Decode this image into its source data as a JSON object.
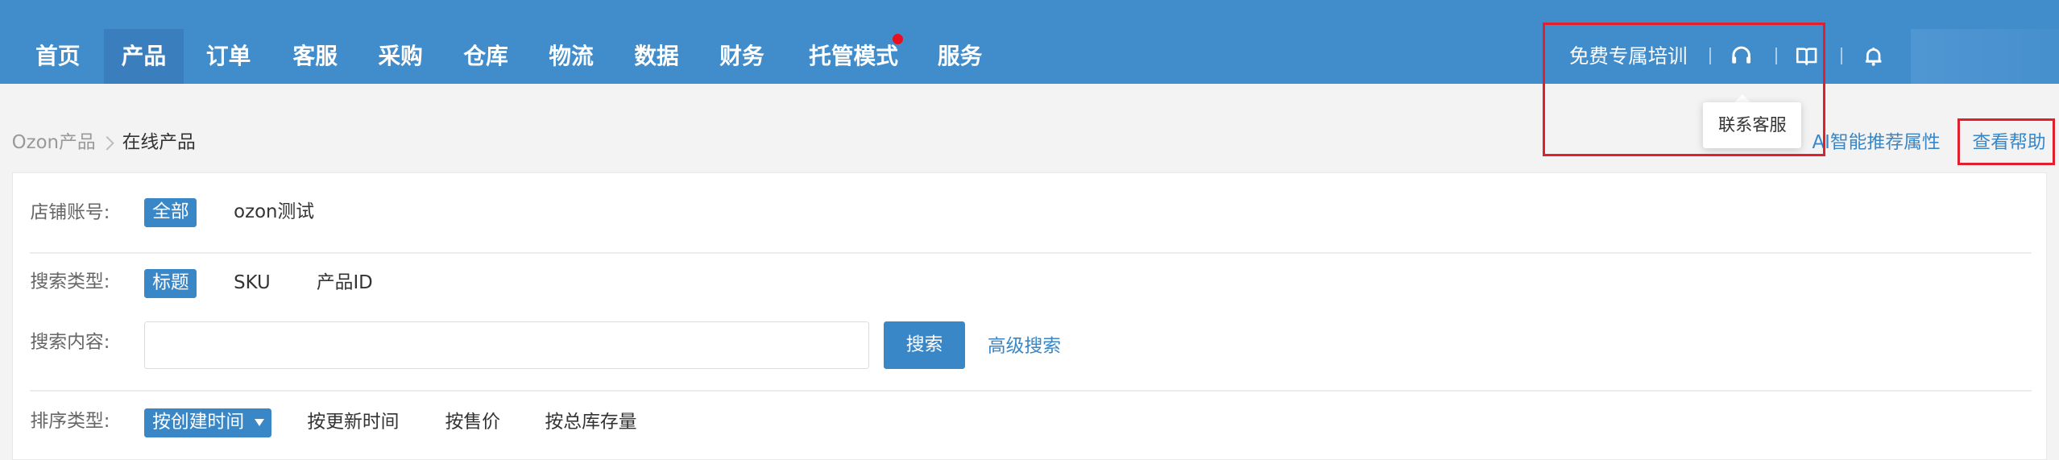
{
  "topnav": {
    "items": [
      {
        "label": "首页",
        "active": false
      },
      {
        "label": "产品",
        "active": true
      },
      {
        "label": "订单",
        "active": false
      },
      {
        "label": "客服",
        "active": false
      },
      {
        "label": "采购",
        "active": false
      },
      {
        "label": "仓库",
        "active": false
      },
      {
        "label": "物流",
        "active": false
      },
      {
        "label": "数据",
        "active": false
      },
      {
        "label": "财务",
        "active": false
      },
      {
        "label": "托管模式",
        "active": false,
        "has_notification_dot": true
      },
      {
        "label": "服务",
        "active": false
      }
    ],
    "training_link": "免费专属培训",
    "icons": [
      "headset-icon",
      "book-icon",
      "bell-icon"
    ]
  },
  "tooltip": {
    "text": "联系客服"
  },
  "breadcrumb": {
    "parent": "Ozon产品",
    "current": "在线产品"
  },
  "header_links": {
    "ai": "AI智能推荐属性",
    "help": "查看帮助"
  },
  "filters": {
    "store": {
      "label": "店铺账号:",
      "options": [
        "全部",
        "ozon测试"
      ],
      "selected": 0
    },
    "search_type": {
      "label": "搜索类型:",
      "options": [
        "标题",
        "SKU",
        "产品ID"
      ],
      "selected": 0
    },
    "search_content": {
      "label": "搜索内容:",
      "value": "",
      "placeholder": "",
      "button": "搜索",
      "advanced": "高级搜索"
    },
    "sort_type": {
      "label": "排序类型:",
      "selected": "按创建时间",
      "options": [
        "按更新时间",
        "按售价",
        "按总库存量"
      ]
    }
  },
  "colors": {
    "topbar": "#418ccb",
    "accent": "#3a87c8",
    "annotation_red": "#e0202c",
    "notification_dot": "#e8101e"
  }
}
